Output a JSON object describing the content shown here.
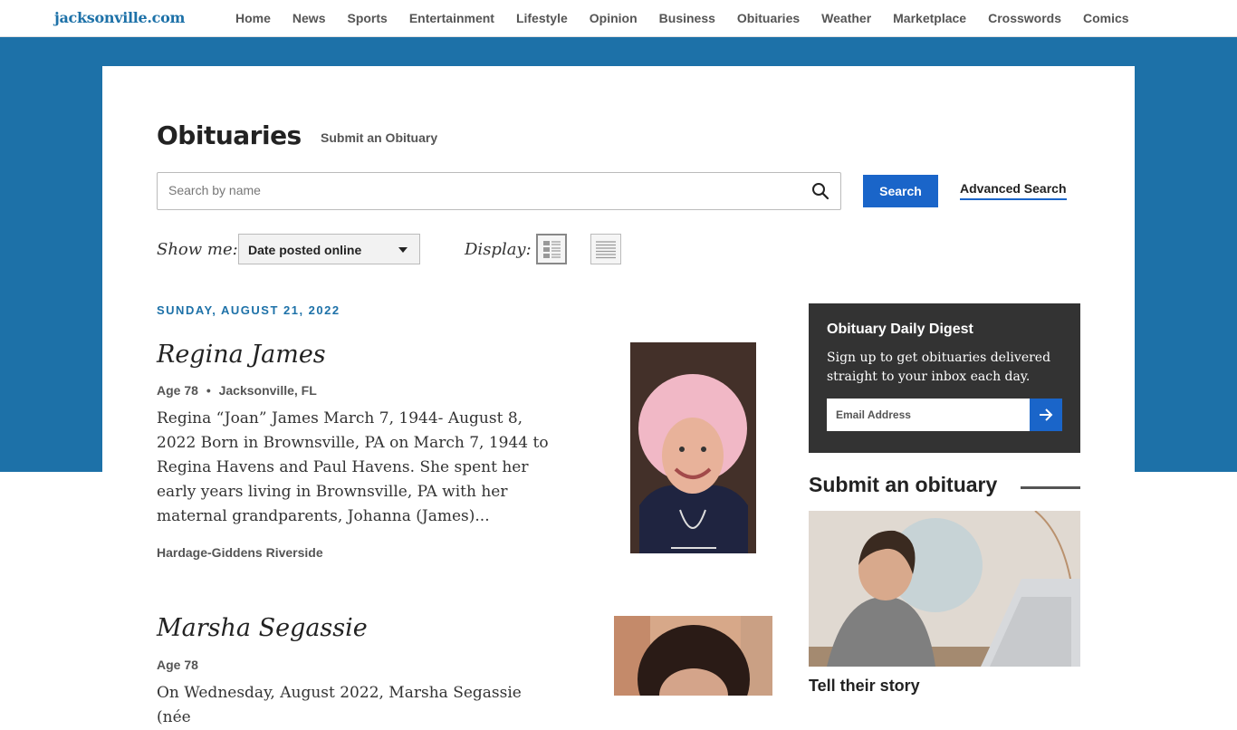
{
  "site": {
    "logo": "jacksonville.com"
  },
  "nav": {
    "items": [
      "Home",
      "News",
      "Sports",
      "Entertainment",
      "Lifestyle",
      "Opinion",
      "Business",
      "Obituaries",
      "Weather",
      "Marketplace",
      "Crosswords",
      "Comics"
    ]
  },
  "page": {
    "title": "Obituaries",
    "submit_link": "Submit an Obituary"
  },
  "search": {
    "placeholder": "Search by name",
    "value": "",
    "button_label": "Search",
    "advanced_label": "Advanced Search"
  },
  "filters": {
    "show_me_label": "Show me:",
    "selected": "Date posted online",
    "display_label": "Display:"
  },
  "listing": {
    "date_header": "SUNDAY, AUGUST 21, 2022",
    "obits": [
      {
        "name": "Regina James",
        "age": "Age 78",
        "location": "Jacksonville, FL",
        "excerpt": "Regina “Joan” James March 7, 1944- August 8, 2022 Born in Brownsville, PA on March 7, 1944 to Regina Havens and Paul Havens. She spent her early years living in Brownsville, PA with her maternal grandparents, Johanna (James)...",
        "funeral_home": "Hardage-Giddens Riverside"
      },
      {
        "name": "Marsha Segassie",
        "age": "Age 78",
        "location": "",
        "excerpt": "On Wednesday, August 2022, Marsha Segassie (née",
        "funeral_home": ""
      }
    ]
  },
  "sidebar": {
    "digest": {
      "title": "Obituary Daily Digest",
      "description": "Sign up to get obituaries delivered straight to your inbox each day.",
      "email_placeholder": "Email Address"
    },
    "submit": {
      "heading": "Submit an obituary",
      "tagline": "Tell their story"
    }
  },
  "colors": {
    "brand_blue": "#1d71a8",
    "button_blue": "#1a65c9",
    "digest_bg": "#333333"
  }
}
